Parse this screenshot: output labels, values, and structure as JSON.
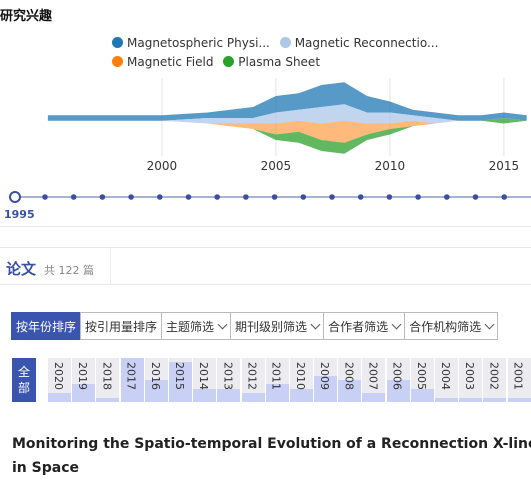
{
  "header": {
    "title": "研究兴趣"
  },
  "legend": [
    {
      "label": "Magnetospheric Physi...",
      "color": "#1f77b4"
    },
    {
      "label": "Magnetic Reconnectio...",
      "color": "#aec7e8"
    },
    {
      "label": "Magnetic Field",
      "color": "#ff7f0e"
    },
    {
      "label": "Plasma Sheet",
      "color": "#2ca02c"
    }
  ],
  "chart_data": {
    "type": "area",
    "x": [
      1995,
      2000,
      2002,
      2004,
      2005,
      2006,
      2007,
      2008,
      2009,
      2010,
      2011,
      2012,
      2013,
      2014,
      2015,
      2016
    ],
    "series": [
      {
        "name": "Magnetospheric Physi...",
        "values": [
          1,
          1,
          1,
          2,
          3,
          3,
          4,
          4,
          3,
          2,
          1,
          1,
          1,
          1,
          1,
          1
        ]
      },
      {
        "name": "Magnetic Reconnectio...",
        "values": [
          0,
          0,
          1,
          1,
          2,
          2,
          3,
          3,
          2,
          2,
          1,
          1,
          0,
          0,
          0,
          0
        ]
      },
      {
        "name": "Magnetic Field",
        "values": [
          0,
          0,
          0,
          1,
          2,
          2,
          3,
          4,
          2,
          1,
          1,
          0,
          0,
          0,
          0,
          0
        ]
      },
      {
        "name": "Plasma Sheet",
        "values": [
          0,
          0,
          0,
          0,
          1,
          2,
          2,
          2,
          1,
          1,
          0,
          0,
          0,
          0,
          1,
          0
        ]
      }
    ],
    "xticks": [
      "2000",
      "2005",
      "2010",
      "2015"
    ]
  },
  "timeline": {
    "selected_year": "1995"
  },
  "papers": {
    "title": "论文",
    "count_text": "共 122 篇"
  },
  "filters": [
    {
      "label": "按年份排序",
      "active": true,
      "dropdown": false
    },
    {
      "label": "按引用量排序",
      "active": false,
      "dropdown": false
    },
    {
      "label": "主题筛选",
      "active": false,
      "dropdown": true
    },
    {
      "label": "期刊级别筛选",
      "active": false,
      "dropdown": true
    },
    {
      "label": "合作者筛选",
      "active": false,
      "dropdown": true
    },
    {
      "label": "合作机构筛选",
      "active": false,
      "dropdown": true
    }
  ],
  "year_filter": {
    "all_label": [
      "全",
      "部"
    ],
    "years": [
      {
        "year": "2020",
        "count": 2
      },
      {
        "year": "2019",
        "count": 4
      },
      {
        "year": "2018",
        "count": 1
      },
      {
        "year": "2017",
        "count": 10
      },
      {
        "year": "2016",
        "count": 5
      },
      {
        "year": "2015",
        "count": 9
      },
      {
        "year": "2014",
        "count": 3
      },
      {
        "year": "2013",
        "count": 3
      },
      {
        "year": "2012",
        "count": 2
      },
      {
        "year": "2011",
        "count": 4
      },
      {
        "year": "2010",
        "count": 3
      },
      {
        "year": "2009",
        "count": 6
      },
      {
        "year": "2008",
        "count": 5
      },
      {
        "year": "2007",
        "count": 2
      },
      {
        "year": "2006",
        "count": 5
      },
      {
        "year": "2005",
        "count": 3
      },
      {
        "year": "2004",
        "count": 1
      },
      {
        "year": "2003",
        "count": 1
      },
      {
        "year": "2002",
        "count": 1
      },
      {
        "year": "2001",
        "count": 1
      }
    ]
  },
  "paper_list": [
    {
      "title": "Monitoring the Spatio-temporal Evolution of a Reconnection X-line in Space"
    }
  ]
}
